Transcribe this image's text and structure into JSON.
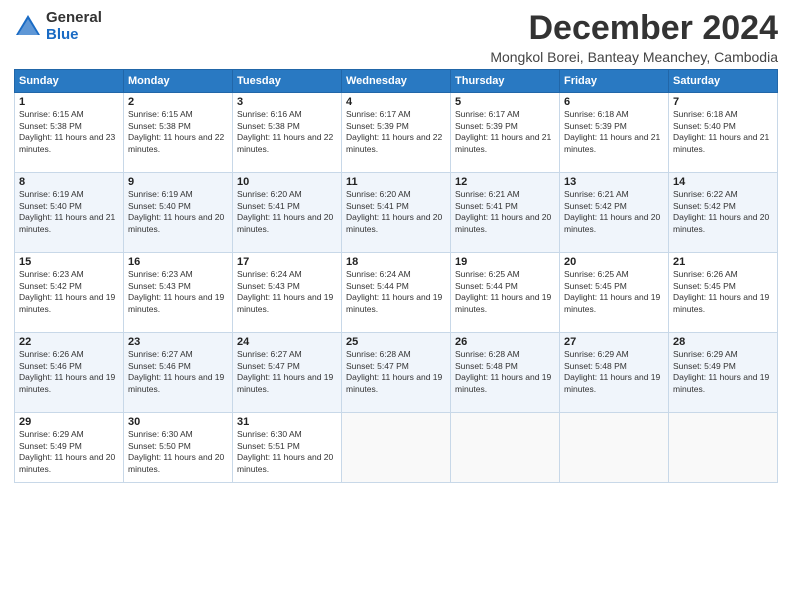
{
  "logo": {
    "general": "General",
    "blue": "Blue"
  },
  "title": "December 2024",
  "subtitle": "Mongkol Borei, Banteay Meanchey, Cambodia",
  "days_header": [
    "Sunday",
    "Monday",
    "Tuesday",
    "Wednesday",
    "Thursday",
    "Friday",
    "Saturday"
  ],
  "weeks": [
    [
      {
        "num": "1",
        "sunrise": "6:15 AM",
        "sunset": "5:38 PM",
        "daylight": "11 hours and 23 minutes."
      },
      {
        "num": "2",
        "sunrise": "6:15 AM",
        "sunset": "5:38 PM",
        "daylight": "11 hours and 22 minutes."
      },
      {
        "num": "3",
        "sunrise": "6:16 AM",
        "sunset": "5:38 PM",
        "daylight": "11 hours and 22 minutes."
      },
      {
        "num": "4",
        "sunrise": "6:17 AM",
        "sunset": "5:39 PM",
        "daylight": "11 hours and 22 minutes."
      },
      {
        "num": "5",
        "sunrise": "6:17 AM",
        "sunset": "5:39 PM",
        "daylight": "11 hours and 21 minutes."
      },
      {
        "num": "6",
        "sunrise": "6:18 AM",
        "sunset": "5:39 PM",
        "daylight": "11 hours and 21 minutes."
      },
      {
        "num": "7",
        "sunrise": "6:18 AM",
        "sunset": "5:40 PM",
        "daylight": "11 hours and 21 minutes."
      }
    ],
    [
      {
        "num": "8",
        "sunrise": "6:19 AM",
        "sunset": "5:40 PM",
        "daylight": "11 hours and 21 minutes."
      },
      {
        "num": "9",
        "sunrise": "6:19 AM",
        "sunset": "5:40 PM",
        "daylight": "11 hours and 20 minutes."
      },
      {
        "num": "10",
        "sunrise": "6:20 AM",
        "sunset": "5:41 PM",
        "daylight": "11 hours and 20 minutes."
      },
      {
        "num": "11",
        "sunrise": "6:20 AM",
        "sunset": "5:41 PM",
        "daylight": "11 hours and 20 minutes."
      },
      {
        "num": "12",
        "sunrise": "6:21 AM",
        "sunset": "5:41 PM",
        "daylight": "11 hours and 20 minutes."
      },
      {
        "num": "13",
        "sunrise": "6:21 AM",
        "sunset": "5:42 PM",
        "daylight": "11 hours and 20 minutes."
      },
      {
        "num": "14",
        "sunrise": "6:22 AM",
        "sunset": "5:42 PM",
        "daylight": "11 hours and 20 minutes."
      }
    ],
    [
      {
        "num": "15",
        "sunrise": "6:23 AM",
        "sunset": "5:42 PM",
        "daylight": "11 hours and 19 minutes."
      },
      {
        "num": "16",
        "sunrise": "6:23 AM",
        "sunset": "5:43 PM",
        "daylight": "11 hours and 19 minutes."
      },
      {
        "num": "17",
        "sunrise": "6:24 AM",
        "sunset": "5:43 PM",
        "daylight": "11 hours and 19 minutes."
      },
      {
        "num": "18",
        "sunrise": "6:24 AM",
        "sunset": "5:44 PM",
        "daylight": "11 hours and 19 minutes."
      },
      {
        "num": "19",
        "sunrise": "6:25 AM",
        "sunset": "5:44 PM",
        "daylight": "11 hours and 19 minutes."
      },
      {
        "num": "20",
        "sunrise": "6:25 AM",
        "sunset": "5:45 PM",
        "daylight": "11 hours and 19 minutes."
      },
      {
        "num": "21",
        "sunrise": "6:26 AM",
        "sunset": "5:45 PM",
        "daylight": "11 hours and 19 minutes."
      }
    ],
    [
      {
        "num": "22",
        "sunrise": "6:26 AM",
        "sunset": "5:46 PM",
        "daylight": "11 hours and 19 minutes."
      },
      {
        "num": "23",
        "sunrise": "6:27 AM",
        "sunset": "5:46 PM",
        "daylight": "11 hours and 19 minutes."
      },
      {
        "num": "24",
        "sunrise": "6:27 AM",
        "sunset": "5:47 PM",
        "daylight": "11 hours and 19 minutes."
      },
      {
        "num": "25",
        "sunrise": "6:28 AM",
        "sunset": "5:47 PM",
        "daylight": "11 hours and 19 minutes."
      },
      {
        "num": "26",
        "sunrise": "6:28 AM",
        "sunset": "5:48 PM",
        "daylight": "11 hours and 19 minutes."
      },
      {
        "num": "27",
        "sunrise": "6:29 AM",
        "sunset": "5:48 PM",
        "daylight": "11 hours and 19 minutes."
      },
      {
        "num": "28",
        "sunrise": "6:29 AM",
        "sunset": "5:49 PM",
        "daylight": "11 hours and 19 minutes."
      }
    ],
    [
      {
        "num": "29",
        "sunrise": "6:29 AM",
        "sunset": "5:49 PM",
        "daylight": "11 hours and 20 minutes."
      },
      {
        "num": "30",
        "sunrise": "6:30 AM",
        "sunset": "5:50 PM",
        "daylight": "11 hours and 20 minutes."
      },
      {
        "num": "31",
        "sunrise": "6:30 AM",
        "sunset": "5:51 PM",
        "daylight": "11 hours and 20 minutes."
      },
      null,
      null,
      null,
      null
    ]
  ]
}
